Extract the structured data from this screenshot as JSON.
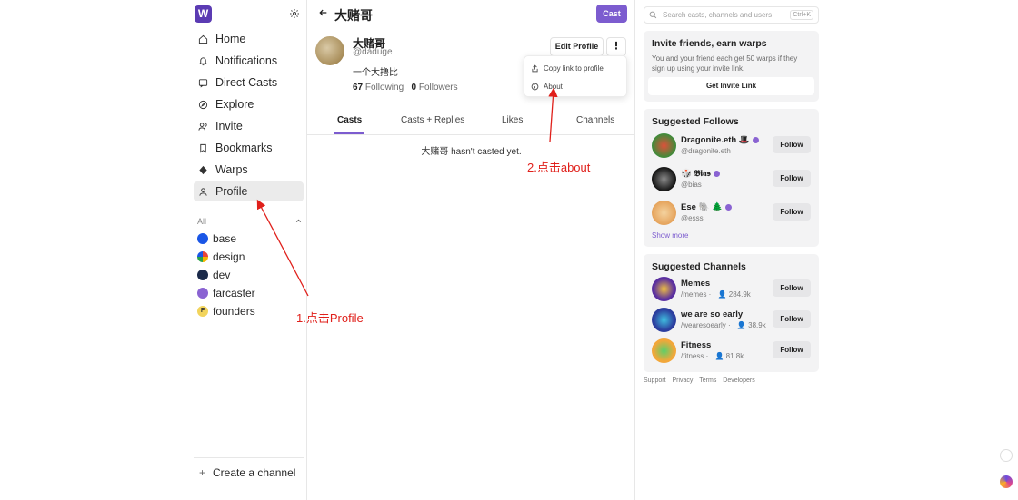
{
  "sidebar": {
    "logo": "W",
    "nav": [
      {
        "label": "Home",
        "icon": "home-icon"
      },
      {
        "label": "Notifications",
        "icon": "bell-icon"
      },
      {
        "label": "Direct Casts",
        "icon": "message-icon"
      },
      {
        "label": "Explore",
        "icon": "compass-icon"
      },
      {
        "label": "Invite",
        "icon": "users-icon"
      },
      {
        "label": "Bookmarks",
        "icon": "bookmark-icon"
      },
      {
        "label": "Warps",
        "icon": "diamond-icon"
      },
      {
        "label": "Profile",
        "icon": "user-icon",
        "active": true
      }
    ],
    "channels_header": "All",
    "channels": [
      {
        "label": "base",
        "color": "#1a56e6"
      },
      {
        "label": "design",
        "color": "#e8453c"
      },
      {
        "label": "dev",
        "color": "#1b2a4a"
      },
      {
        "label": "farcaster",
        "color": "#8a63d2"
      },
      {
        "label": "founders",
        "color": "#f2d45c",
        "letter": "F"
      }
    ],
    "create_channel": "Create a channel"
  },
  "main": {
    "title": "大赌哥",
    "cast_button": "Cast",
    "profile": {
      "display_name": "大赌哥",
      "username": "@daduge",
      "bio": "一个大撸比",
      "following_count": "67",
      "following_label": "Following",
      "followers_count": "0",
      "followers_label": "Followers"
    },
    "edit_profile": "Edit Profile",
    "more_button": "⋮",
    "menu": [
      {
        "label": "Copy link to profile",
        "icon": "share-icon"
      },
      {
        "label": "About",
        "icon": "info-icon"
      }
    ],
    "tabs": [
      {
        "label": "Casts",
        "active": true
      },
      {
        "label": "Casts + Replies"
      },
      {
        "label": "Likes"
      },
      {
        "label": "Channels"
      }
    ],
    "empty_message": "大赌哥 hasn't casted yet."
  },
  "right": {
    "search_placeholder": "Search casts, channels and users",
    "search_shortcut": "Ctrl+K",
    "invite": {
      "title": "Invite friends, earn warps",
      "description": "You and your friend each get 50 warps if they sign up using your invite link.",
      "button": "Get Invite Link"
    },
    "suggested_follows": {
      "title": "Suggested Follows",
      "items": [
        {
          "name": "Dragonite.eth 🎩",
          "handle": "@dragonite.eth",
          "button": "Follow",
          "color": "#3a8d3a"
        },
        {
          "name": "🎲 𝕭𝖎𝖆𝖘",
          "handle": "@bias",
          "button": "Follow",
          "color": "#222222"
        },
        {
          "name": "Ese 🐘 🌲",
          "handle": "@esss",
          "button": "Follow",
          "color": "#e5a25a"
        }
      ],
      "show_more": "Show more"
    },
    "suggested_channels": {
      "title": "Suggested Channels",
      "items": [
        {
          "name": "Memes",
          "handle": "/memes",
          "members": "284.9k",
          "button": "Follow",
          "color": "#5a2fa0"
        },
        {
          "name": "we are so early",
          "handle": "/wearesoearly",
          "members": "38.9k",
          "button": "Follow",
          "color": "#2c3e9e"
        },
        {
          "name": "Fitness",
          "handle": "/fitness",
          "members": "81.8k",
          "button": "Follow",
          "color": "#f2a73a"
        }
      ]
    },
    "footer": [
      "Support",
      "Privacy",
      "Terms",
      "Developers"
    ]
  },
  "annotations": {
    "step1": "1.点击Profile",
    "step2": "2.点击about",
    "color": "#e0201b"
  }
}
